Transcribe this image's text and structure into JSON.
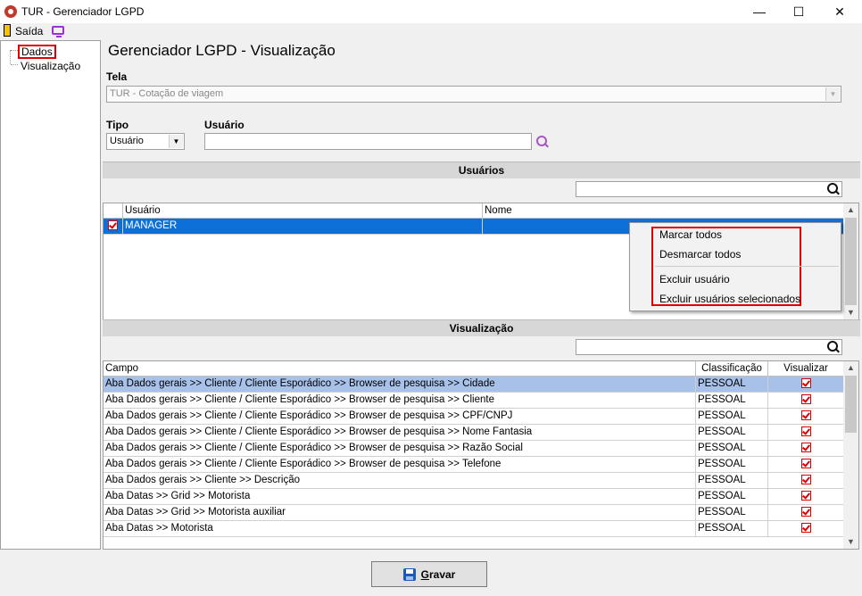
{
  "window": {
    "title": "TUR - Gerenciador LGPD",
    "min": "—",
    "max": "☐",
    "close": "✕"
  },
  "menubar": {
    "exit_label": "Saída"
  },
  "tree": {
    "items": [
      "Dados",
      "Visualização"
    ]
  },
  "page_title": "Gerenciador LGPD - Visualização",
  "tela": {
    "label": "Tela",
    "value": "TUR - Cotação de viagem"
  },
  "tipo": {
    "label": "Tipo",
    "value": "Usuário"
  },
  "usuario": {
    "label": "Usuário",
    "value": ""
  },
  "users_section": {
    "title": "Usuários",
    "search_value": "",
    "columns": [
      "Usuário",
      "Nome"
    ],
    "rows": [
      {
        "checked": true,
        "usuario": "MANAGER",
        "nome": ""
      }
    ]
  },
  "context_menu": {
    "items": [
      "Marcar todos",
      "Desmarcar todos",
      "Excluir usuário",
      "Excluir usuários selecionados"
    ]
  },
  "vis_section": {
    "title": "Visualização",
    "search_value": "",
    "columns": [
      "Campo",
      "Classificação",
      "Visualizar"
    ],
    "rows": [
      {
        "campo": "Aba Dados gerais >> Cliente / Cliente Esporádico >> Browser de pesquisa >> Cidade",
        "classificacao": "PESSOAL",
        "visualizar": true
      },
      {
        "campo": "Aba Dados gerais >> Cliente / Cliente Esporádico >> Browser de pesquisa >> Cliente",
        "classificacao": "PESSOAL",
        "visualizar": true
      },
      {
        "campo": "Aba Dados gerais >> Cliente / Cliente Esporádico >> Browser de pesquisa >> CPF/CNPJ",
        "classificacao": "PESSOAL",
        "visualizar": true
      },
      {
        "campo": "Aba Dados gerais >> Cliente / Cliente Esporádico >> Browser de pesquisa >> Nome Fantasia",
        "classificacao": "PESSOAL",
        "visualizar": true
      },
      {
        "campo": "Aba Dados gerais >> Cliente / Cliente Esporádico >> Browser de pesquisa >> Razão Social",
        "classificacao": "PESSOAL",
        "visualizar": true
      },
      {
        "campo": "Aba Dados gerais >> Cliente / Cliente Esporádico >> Browser de pesquisa >> Telefone",
        "classificacao": "PESSOAL",
        "visualizar": true
      },
      {
        "campo": "Aba Dados gerais >> Cliente >> Descrição",
        "classificacao": "PESSOAL",
        "visualizar": true
      },
      {
        "campo": "Aba Datas >> Grid >> Motorista",
        "classificacao": "PESSOAL",
        "visualizar": true
      },
      {
        "campo": "Aba Datas >> Grid >> Motorista auxiliar",
        "classificacao": "PESSOAL",
        "visualizar": true
      },
      {
        "campo": "Aba Datas >> Motorista",
        "classificacao": "PESSOAL",
        "visualizar": true
      }
    ]
  },
  "save_button": {
    "first": "G",
    "rest": "ravar"
  }
}
